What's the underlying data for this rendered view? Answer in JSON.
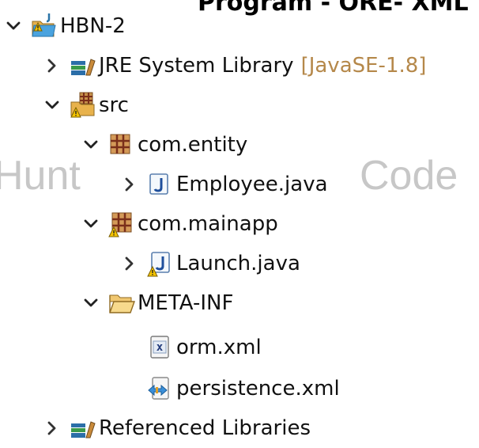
{
  "header_text": "Program - ORE- XML",
  "watermark": {
    "left": "Hunt",
    "right": "Code"
  },
  "tree": {
    "project": {
      "label": "HBN-2",
      "icon": "project-folder-icon"
    },
    "jre": {
      "label": "JRE System Library",
      "suffix": "[JavaSE-1.8]",
      "icon": "library-icon"
    },
    "src": {
      "label": "src",
      "icon": "source-folder-icon"
    },
    "pkg_entity": {
      "label": "com.entity",
      "icon": "package-icon"
    },
    "employee": {
      "label": "Employee.java",
      "icon": "java-file-icon"
    },
    "pkg_mainapp": {
      "label": "com.mainapp",
      "icon": "package-icon"
    },
    "launch": {
      "label": "Launch.java",
      "icon": "java-file-icon"
    },
    "metainf": {
      "label": "META-INF",
      "icon": "open-folder-icon"
    },
    "orm": {
      "label": "orm.xml",
      "icon": "xml-file-icon"
    },
    "persistence": {
      "label": "persistence.xml",
      "icon": "persistence-file-icon"
    },
    "reflibs": {
      "label": "Referenced Libraries",
      "icon": "library-icon"
    }
  }
}
